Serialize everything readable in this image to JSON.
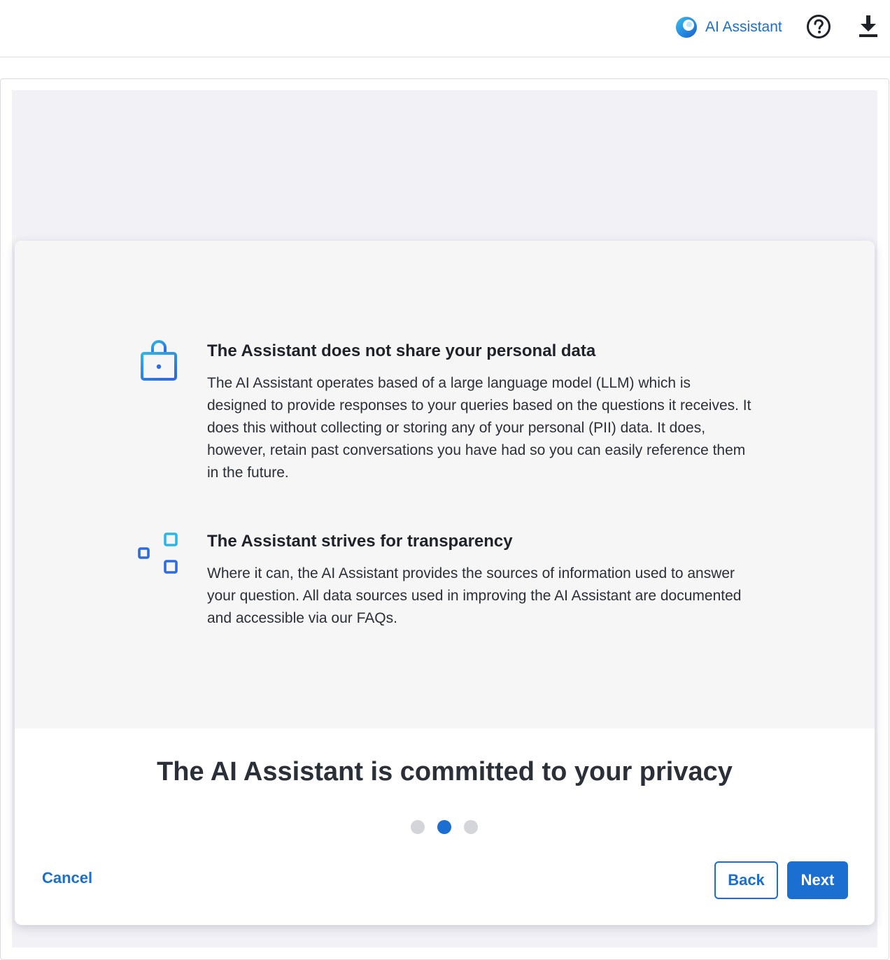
{
  "header": {
    "ai_assistant_label": "AI Assistant",
    "icons": [
      "ai-assistant-logo-icon",
      "help-icon",
      "download-icon"
    ]
  },
  "modal": {
    "features": [
      {
        "icon": "lock-icon",
        "title": "The Assistant does not share your personal data",
        "text": "The AI Assistant operates based of a large language model (LLM) which is designed to provide responses to your queries based on the questions it receives. It does this without collecting or storing any of your personal (PII) data. It does, however, retain past conversations you have had so you can easily reference them in the future."
      },
      {
        "icon": "sitemap-icon",
        "title": "The Assistant strives for transparency",
        "text": "Where it can, the AI Assistant provides the sources of information used to answer your question. All data sources used in improving the AI Assistant are documented and accessible via our FAQs."
      }
    ],
    "title": "The AI Assistant is committed to your privacy",
    "pagination": {
      "total": 3,
      "current": 2
    },
    "cancel_label": "Cancel",
    "back_label": "Back",
    "next_label": "Next"
  },
  "colors": {
    "accent": "#1a6fd1",
    "icon_gradient_start": "#29b6e8",
    "icon_gradient_end": "#2f6be0",
    "dot_inactive": "#d3d5db",
    "backdrop": "#f1f1f6",
    "body_panel": "#f6f6f7"
  }
}
